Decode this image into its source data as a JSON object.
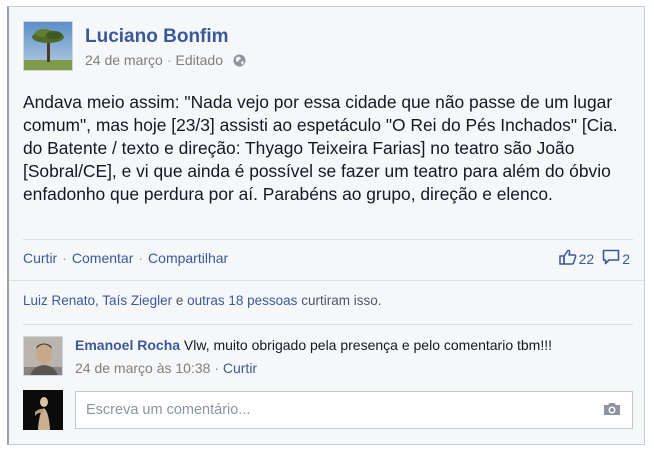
{
  "post": {
    "author": "Luciano Bonfim",
    "date": "24 de março",
    "separator": "·",
    "edited": "Editado",
    "privacy_icon": "globe-icon",
    "text": "Andava meio assim: \"Nada vejo por essa cidade que não passe de um lugar comum\", mas hoje [23/3] assisti ao espetáculo \"O Rei do Pés Inchados\" [Cia. do Batente / texto e direção: Thyago Teixeira Farias] no teatro são João [Sobral/CE], e vi que ainda é possível se fazer um teatro para além do óbvio enfadonho que perdura por aí. Parabéns ao grupo, direção e elenco."
  },
  "actions": {
    "like": "Curtir",
    "comment": "Comentar",
    "share": "Compartilhar",
    "dot": "·",
    "like_count": "22",
    "comment_count": "2",
    "like_icon": "thumbs-up-icon",
    "comment_icon": "comment-bubble-icon"
  },
  "likes_summary": {
    "names": "Luiz Renato, Taís Ziegler",
    "connector": " e ",
    "others": "outras 18 pessoas",
    "suffix": " curtiram isso."
  },
  "comments": [
    {
      "author": "Emanoel Rocha",
      "text": "Vlw, muito obrigado pela presença e pelo comentario tbm!!!",
      "timestamp": "24 de março às 10:38",
      "dot": "·",
      "like": "Curtir"
    }
  ],
  "composer": {
    "placeholder": "Escreva um comentário...",
    "camera_icon": "camera-icon"
  },
  "colors": {
    "link": "#3b5998",
    "background": "#f6f7f9",
    "text": "#141823",
    "muted": "#7f7f7f"
  }
}
